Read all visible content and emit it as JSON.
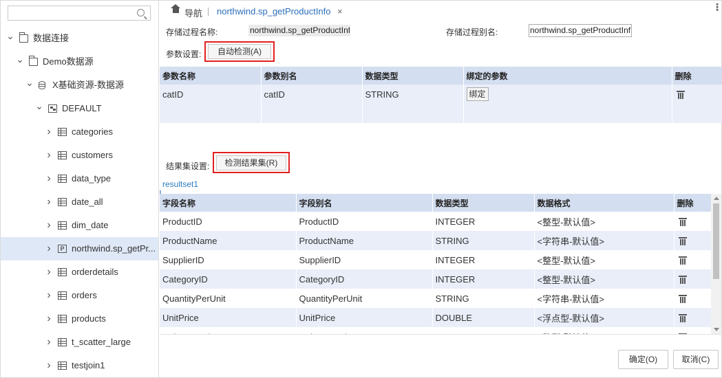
{
  "sidebar": {
    "search": {
      "placeholder": "",
      "value": ""
    },
    "tree": [
      {
        "label": "数据连接",
        "icon": "folder-icon",
        "expanded": true
      },
      {
        "label": "Demo数据源",
        "icon": "folder-icon",
        "expanded": true
      },
      {
        "label": "X基础资源-数据源",
        "icon": "database-icon",
        "expanded": true
      },
      {
        "label": "DEFAULT",
        "icon": "schema-icon",
        "expanded": true
      },
      {
        "label": "categories",
        "icon": "table-icon"
      },
      {
        "label": "customers",
        "icon": "table-icon"
      },
      {
        "label": "data_type",
        "icon": "table-icon"
      },
      {
        "label": "date_all",
        "icon": "table-icon"
      },
      {
        "label": "dim_date",
        "icon": "table-icon"
      },
      {
        "label": "northwind.sp_getPr...",
        "icon": "procedure-icon",
        "selected": true
      },
      {
        "label": "orderdetails",
        "icon": "table-icon"
      },
      {
        "label": "orders",
        "icon": "table-icon"
      },
      {
        "label": "products",
        "icon": "table-icon"
      },
      {
        "label": "t_scatter_large",
        "icon": "table-icon"
      },
      {
        "label": "testjoin1",
        "icon": "table-icon"
      }
    ]
  },
  "tabbar": {
    "nav_label": "导航",
    "tab_title": "northwind.sp_getProductInfo",
    "close": "×",
    "more": "⋮"
  },
  "form": {
    "proc_name_label": "存储过程名称:",
    "proc_name_value": "northwind.sp_getProductInf",
    "proc_alias_label": "存储过程别名:",
    "proc_alias_value": "northwind.sp_getProductInf",
    "params_label": "参数设置:",
    "auto_detect_button": "自动检测(A)",
    "result_label": "结果集设置:",
    "detect_result_button": "检测结果集(R)",
    "resultset_name": "resultset1"
  },
  "params_table": {
    "headers": [
      "参数名称",
      "参数别名",
      "数据类型",
      "绑定的参数",
      "删除"
    ],
    "rows": [
      {
        "name": "catID",
        "alias": "catID",
        "type": "STRING",
        "bind_label": "绑定"
      }
    ]
  },
  "result_table": {
    "headers": [
      "字段名称",
      "字段别名",
      "数据类型",
      "数据格式",
      "删除"
    ],
    "rows": [
      {
        "name": "ProductID",
        "alias": "ProductID",
        "type": "INTEGER",
        "format": "<整型-默认值>"
      },
      {
        "name": "ProductName",
        "alias": "ProductName",
        "type": "STRING",
        "format": "<字符串-默认值>"
      },
      {
        "name": "SupplierID",
        "alias": "SupplierID",
        "type": "INTEGER",
        "format": "<整型-默认值>"
      },
      {
        "name": "CategoryID",
        "alias": "CategoryID",
        "type": "INTEGER",
        "format": "<整型-默认值>"
      },
      {
        "name": "QuantityPerUnit",
        "alias": "QuantityPerUnit",
        "type": "STRING",
        "format": "<字符串-默认值>"
      },
      {
        "name": "UnitPrice",
        "alias": "UnitPrice",
        "type": "DOUBLE",
        "format": "<浮点型-默认值>"
      },
      {
        "name": "UnitsInStock",
        "alias": "UnitsInStock",
        "type": "INTEGER",
        "format": "<整型-默认值>"
      }
    ]
  },
  "footer": {
    "ok_button": "确定(O)",
    "cancel_button": "取消(C)"
  },
  "colors": {
    "header_bg": "#d3def0",
    "alt_row_bg": "#e9eef9",
    "selected_bg": "#dfe8f6",
    "accent_link": "#2a6ebb",
    "highlight_border": "#e02020"
  }
}
